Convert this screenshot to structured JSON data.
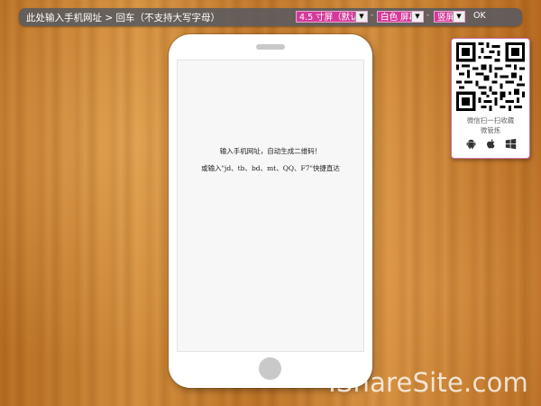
{
  "toolbar": {
    "url_text": "此处输入手机网址 > 回车（不支持大写字母）",
    "screen_size": "4.5 寸屏（默认）",
    "screen_color": "白色 屏幕",
    "orientation": "竖屏",
    "ok_label": "OK",
    "accent_color": "#d43a9a"
  },
  "screen": {
    "hint_line1": "输入手机网址，自动生成二维码！",
    "hint_line2": "或输入\"jd、tb、bd、mt、QQ、F7\"快捷直达"
  },
  "qr_panel": {
    "caption1": "微信扫一扫收藏",
    "caption2": "微管炼",
    "os_icons": [
      "android-icon",
      "apple-icon",
      "windows-icon"
    ]
  },
  "watermark": "IShareSite.com"
}
